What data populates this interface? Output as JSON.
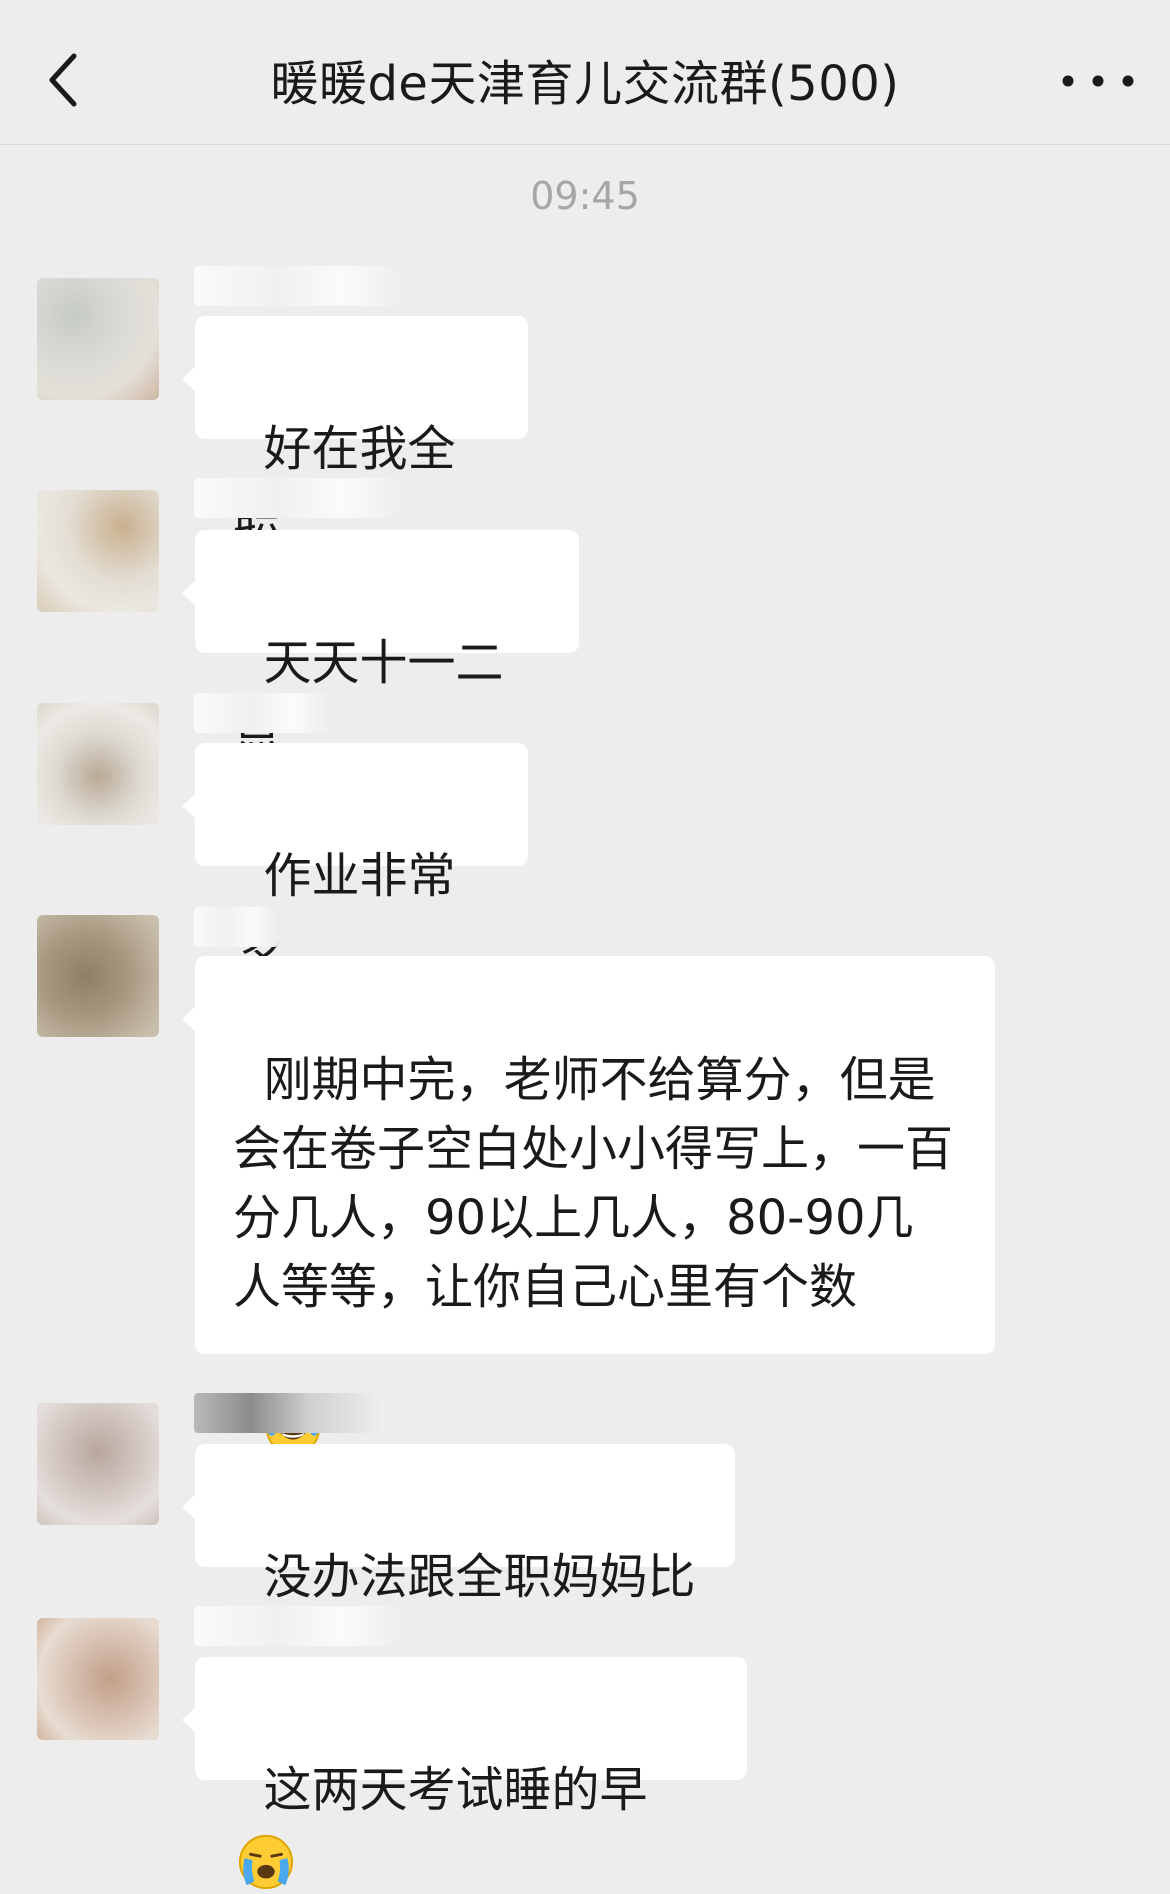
{
  "header": {
    "title": "暖暖de天津育儿交流群(500)",
    "back_icon": "chevron-left-icon",
    "more_icon": "more-dots-icon"
  },
  "timestamp": "09:45",
  "messages": [
    {
      "text": "好在我全职"
    },
    {
      "text": "天天十一二点"
    },
    {
      "text": "作业非常多"
    },
    {
      "text": "刚期中完，老师不给算分，但是会在卷子空白处小小得写上，一百分几人，90以上几人，80-90几人等等，让你自己心里有个数",
      "emoji": "face-with-tears-of-joy"
    },
    {
      "text": "没办法跟全职妈妈比"
    },
    {
      "text": "这两天考试睡的早",
      "emoji": "loudly-crying-face"
    }
  ]
}
